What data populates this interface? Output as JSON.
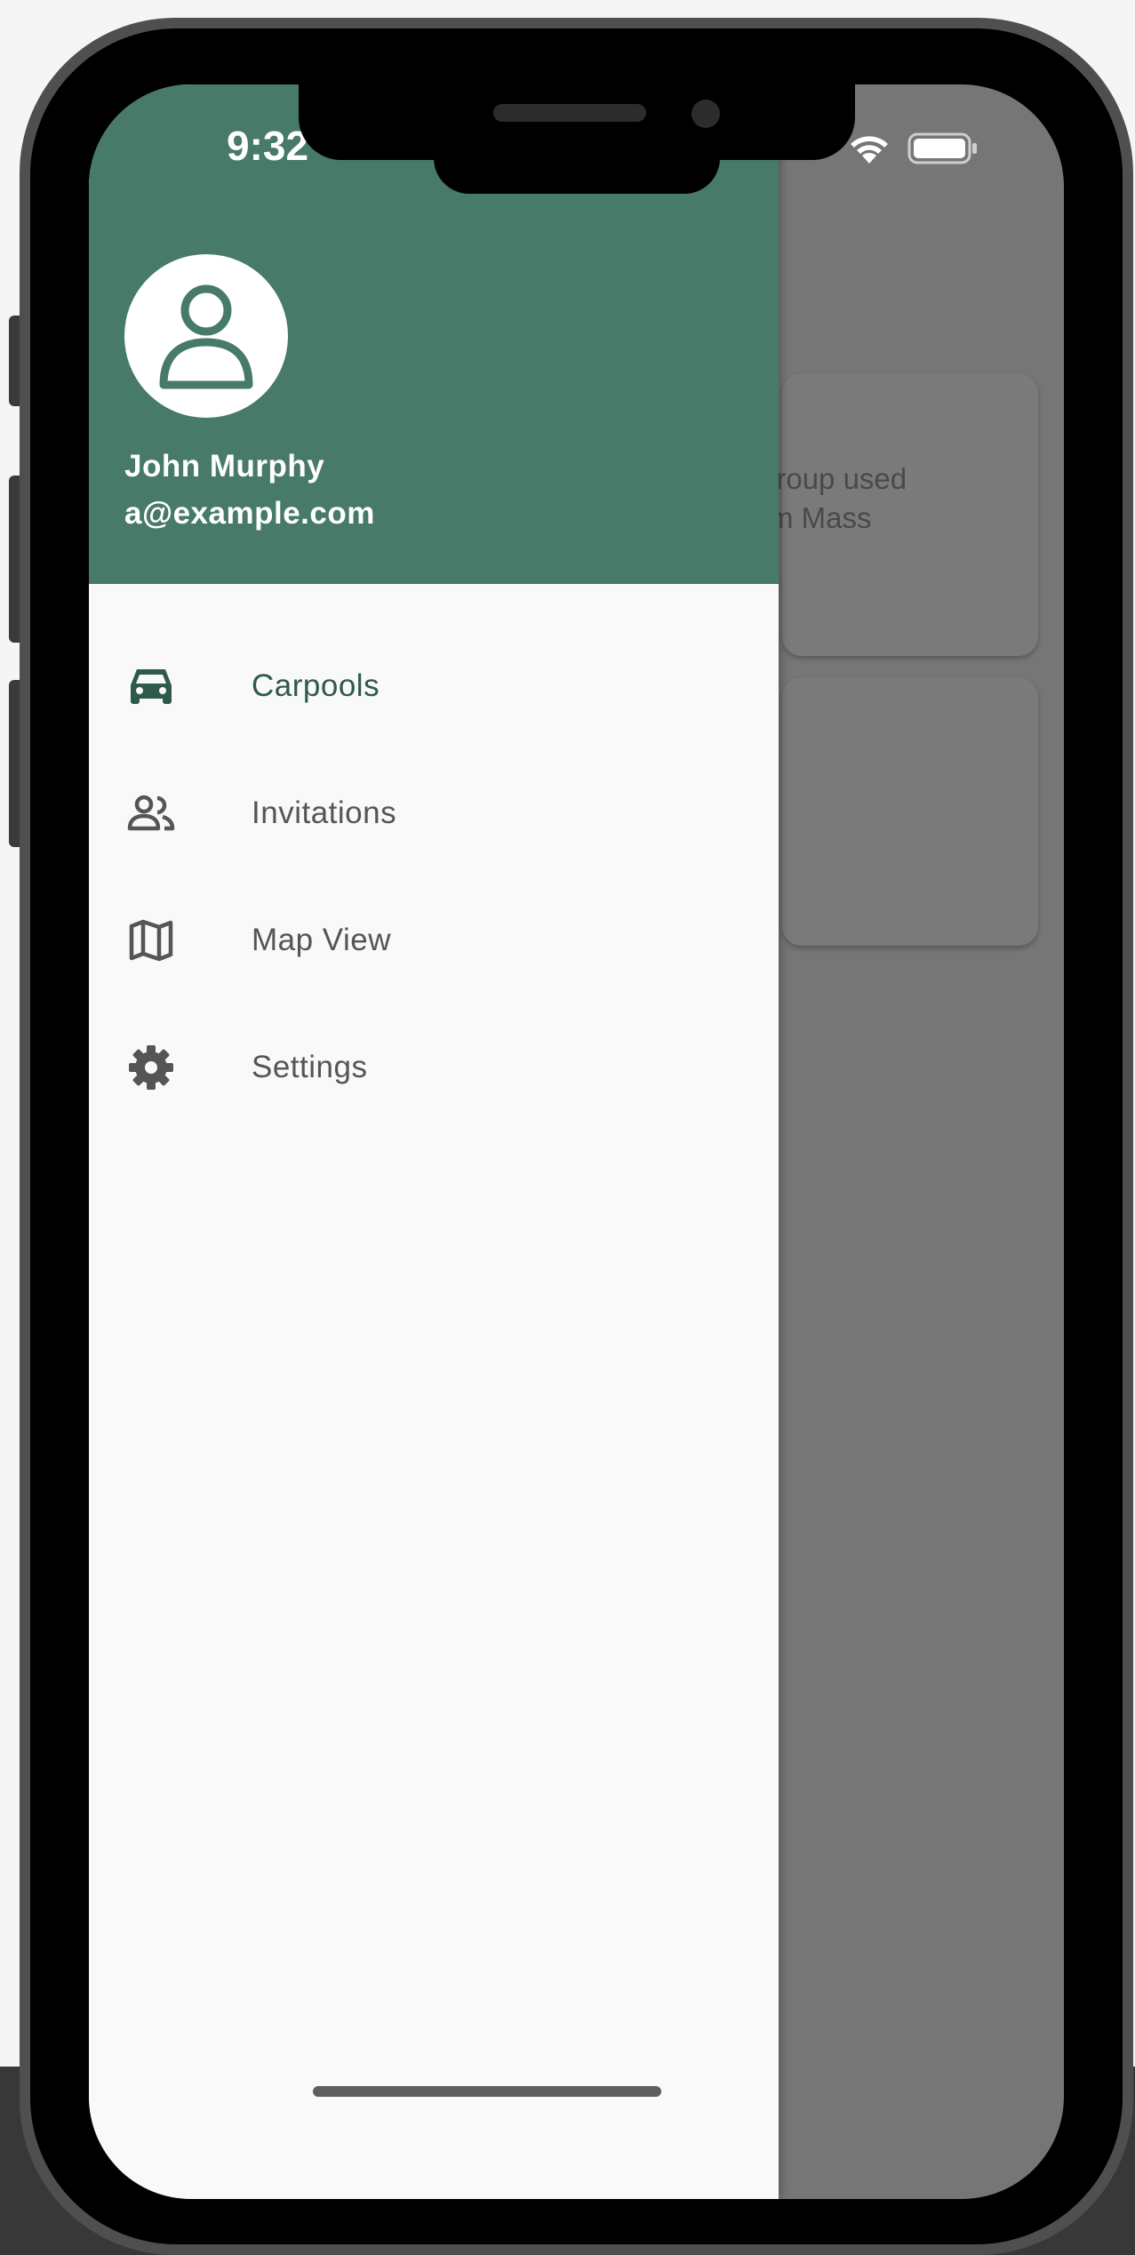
{
  "status_bar": {
    "time": "9:32"
  },
  "drawer": {
    "user_name": "John Murphy",
    "user_email": "a@example.com",
    "items": [
      {
        "label": "Carpools",
        "icon": "car-icon",
        "active": true
      },
      {
        "label": "Invitations",
        "icon": "people-icon",
        "active": false
      },
      {
        "label": "Map View",
        "icon": "map-icon",
        "active": false
      },
      {
        "label": "Settings",
        "icon": "gear-icon",
        "active": false
      }
    ]
  },
  "background": {
    "card_text_line1": "group used",
    "card_text_line2": "m Mass"
  },
  "colors": {
    "header": "#477a68",
    "accent_text": "#2f5a4b",
    "drawer_bg": "#f9f9f9",
    "scrim": "#767676"
  }
}
